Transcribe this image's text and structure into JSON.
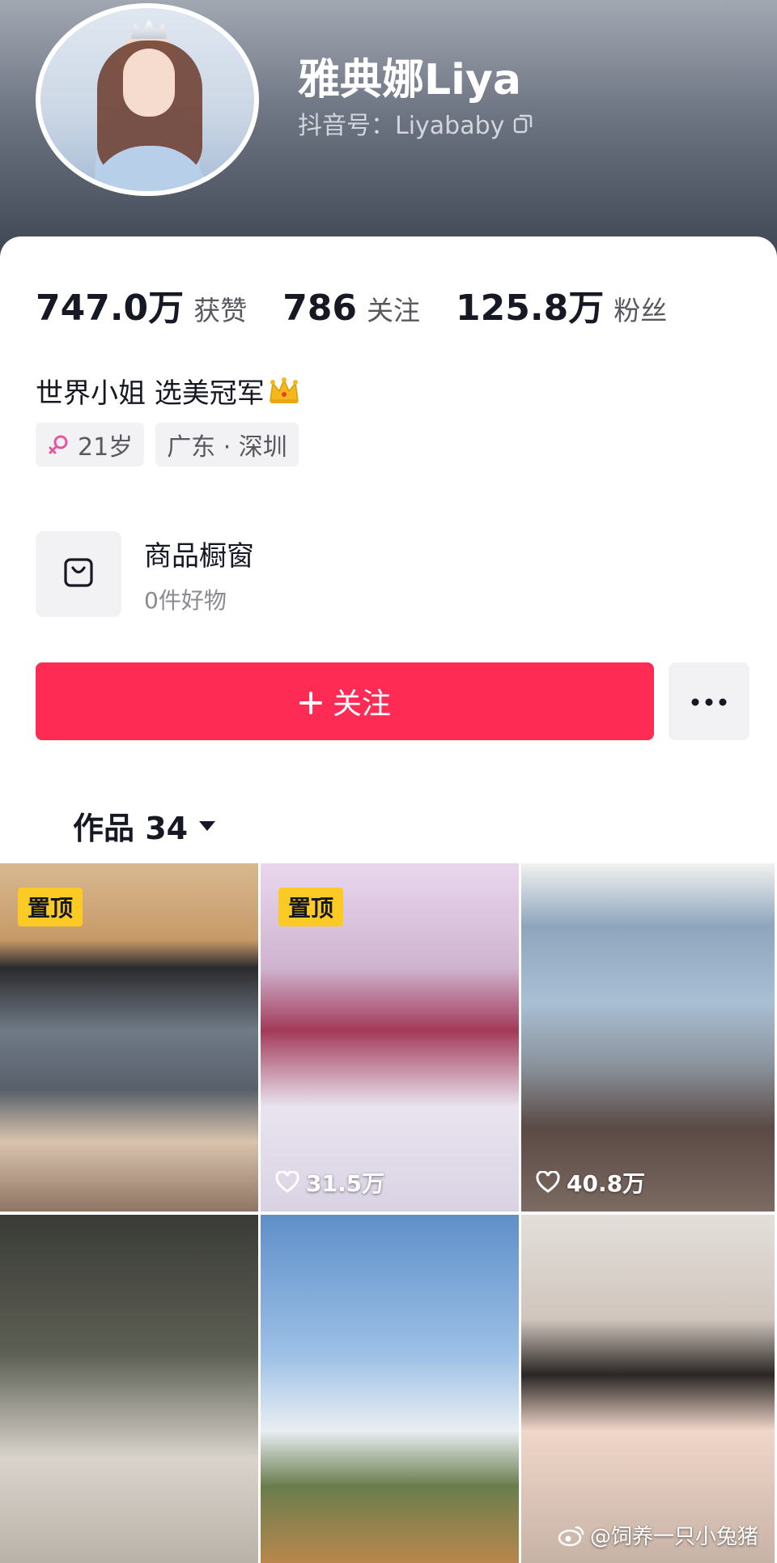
{
  "profile": {
    "username": "雅典娜Liya",
    "douyin_id": "抖音号：Liyababy"
  },
  "stats": [
    {
      "value": "747.0万",
      "label": "获赞"
    },
    {
      "value": "786",
      "label": "关注"
    },
    {
      "value": "125.8万",
      "label": "粉丝"
    }
  ],
  "bio": "世界小姐 选美冠军",
  "tags": {
    "age": "21岁",
    "location": "广东 · 深圳"
  },
  "shop": {
    "title": "商品橱窗",
    "subtitle": "0件好物"
  },
  "actions": {
    "follow_label": "关注"
  },
  "works": {
    "tab_label": "作品 34"
  },
  "videos": [
    {
      "pinned": "置顶",
      "likes": ""
    },
    {
      "pinned": "置顶",
      "likes": "31.5万"
    },
    {
      "pinned": "",
      "likes": "40.8万"
    },
    {
      "pinned": "",
      "likes": ""
    },
    {
      "pinned": "",
      "likes": ""
    },
    {
      "pinned": "",
      "likes": ""
    }
  ],
  "watermark": "@饲养一只小兔猪",
  "colors": {
    "accent": "#fe2c55",
    "pin_badge": "#fcca24"
  },
  "icons": [
    "copy-icon",
    "crown-icon",
    "female-icon",
    "shopping-bag-icon",
    "plus-icon",
    "more-icon",
    "caret-down-icon",
    "heart-icon",
    "weibo-icon"
  ]
}
